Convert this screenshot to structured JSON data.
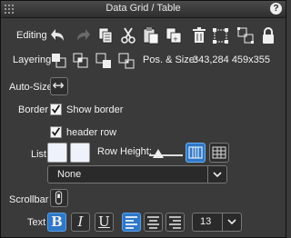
{
  "window": {
    "title": "Data Grid / Table",
    "help_label": "?"
  },
  "editing": {
    "label": "Editing",
    "tools": [
      "undo-icon",
      "redo-icon",
      "copy-icon",
      "cut-icon",
      "paste-icon",
      "duplicate-icon",
      "delete-icon",
      "group-icon",
      "ungroup-icon",
      "lock-icon"
    ]
  },
  "layering": {
    "label": "Layering",
    "tools": [
      "bring-to-front-icon",
      "bring-forward-icon",
      "send-backward-icon",
      "send-to-back-icon"
    ],
    "pos_size_label": "Pos. & Size:",
    "pos_size_value": "343,284 459x355"
  },
  "autosize": {
    "label": "Auto-Size"
  },
  "border": {
    "label": "Border",
    "show_border_label": "Show border",
    "show_border_checked": true
  },
  "header_row": {
    "label": "header row",
    "checked": true
  },
  "list": {
    "label": "List",
    "row_height_label": "Row Height:",
    "row_height_level": 0.15,
    "style_select_value": "None"
  },
  "scrollbar": {
    "label": "Scrollbar"
  },
  "text": {
    "label": "Text",
    "bold_label": "B",
    "italic_label": "I",
    "underline_label": "U",
    "bold_active": true,
    "align_left_active": true,
    "font_size_value": "13"
  },
  "colors": {
    "accent": "#2f77c7",
    "panel": "#3a3a3a"
  }
}
